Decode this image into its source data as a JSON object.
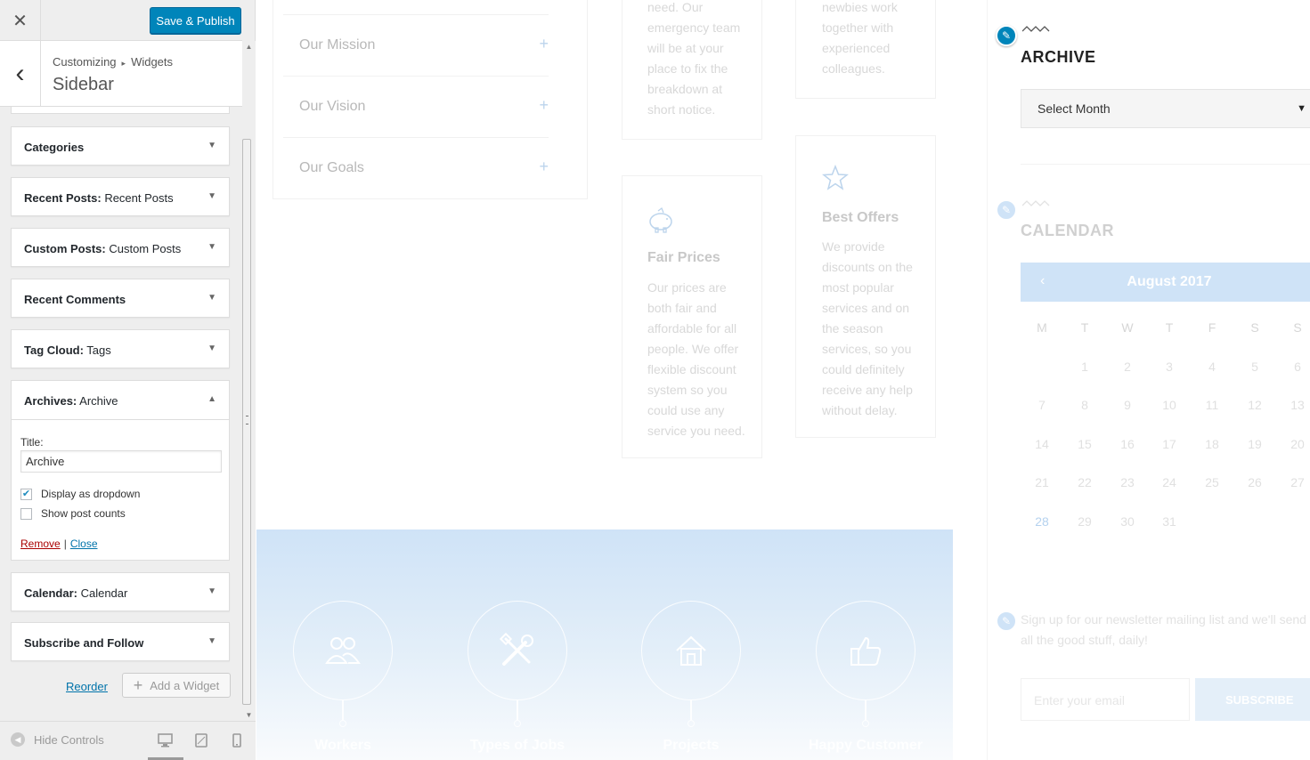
{
  "topbar": {
    "close_symbol": "✕",
    "save_label": "Save & Publish"
  },
  "section": {
    "breadcrumb_root": "Customizing",
    "breadcrumb_sep": "▸",
    "breadcrumb_current": "Widgets",
    "title": "Sidebar",
    "back_symbol": "‹"
  },
  "widgets": [
    {
      "name": "Categories",
      "subtitle": ""
    },
    {
      "name": "Recent Posts:",
      "subtitle": " Recent Posts"
    },
    {
      "name": "Custom Posts:",
      "subtitle": " Custom Posts"
    },
    {
      "name": "Recent Comments",
      "subtitle": ""
    },
    {
      "name": "Tag Cloud:",
      "subtitle": " Tags"
    }
  ],
  "open_widget": {
    "name": "Archives:",
    "subtitle": " Archive",
    "title_label": "Title:",
    "title_value": "Archive",
    "dropdown_label": "Display as dropdown",
    "dropdown_checked": true,
    "counts_label": "Show post counts",
    "counts_checked": false,
    "remove_label": "Remove",
    "close_label": "Close"
  },
  "widgets_after": [
    {
      "name": "Calendar:",
      "subtitle": " Calendar"
    },
    {
      "name": "Subscribe and Follow",
      "subtitle": ""
    }
  ],
  "actions": {
    "reorder": "Reorder",
    "add_widget": "Add a Widget"
  },
  "footer": {
    "hide_controls": "Hide Controls"
  },
  "preview": {
    "accordion": [
      "Our Mission",
      "Our Vision",
      "Our Goals"
    ],
    "card1_top_text": [
      "need. Our",
      "emergency team",
      "will be at your",
      "place to fix the",
      "breakdown at",
      "short notice."
    ],
    "card2_top_text": [
      "newbies work",
      "together with",
      "experienced",
      "colleagues."
    ],
    "fair_prices": {
      "title": "Fair Prices",
      "text": [
        "Our prices are",
        "both fair and",
        "affordable for all",
        "people. We offer",
        "flexible discount",
        "system so you",
        "could use any",
        "service you need."
      ]
    },
    "best_offers": {
      "title": "Best Offers",
      "text": [
        "We provide",
        "discounts on the",
        "most popular",
        "services and on",
        "the season",
        "services, so you",
        "could definitely",
        "receive any help",
        "without delay."
      ]
    },
    "band_items": [
      "Workers",
      "Types of Jobs",
      "Projects",
      "Happy Customer"
    ],
    "archive": {
      "heading": "ARCHIVE",
      "select_value": "Select Month"
    },
    "calendar": {
      "heading": "CALENDAR",
      "month": "August 2017",
      "prev": "‹",
      "dow": [
        "M",
        "T",
        "W",
        "T",
        "F",
        "S",
        "S"
      ],
      "weeks": [
        [
          "",
          "1",
          "2",
          "3",
          "4",
          "5",
          "6"
        ],
        [
          "7",
          "8",
          "9",
          "10",
          "11",
          "12",
          "13"
        ],
        [
          "14",
          "15",
          "16",
          "17",
          "18",
          "19",
          "20"
        ],
        [
          "21",
          "22",
          "23",
          "24",
          "25",
          "26",
          "27"
        ],
        [
          "28",
          "29",
          "30",
          "31",
          "",
          "",
          ""
        ]
      ],
      "today": "28"
    },
    "newsletter": {
      "line1": "Sign up for our newsletter mailing list and we'll send yo",
      "line2": "all the good stuff, daily!",
      "placeholder": "Enter your email",
      "button": "SUBSCRIBE"
    }
  },
  "colors": {
    "accent": "#0085ba",
    "link": "#0073aa",
    "remove": "#aa0000",
    "band": "#cfe3f7"
  }
}
